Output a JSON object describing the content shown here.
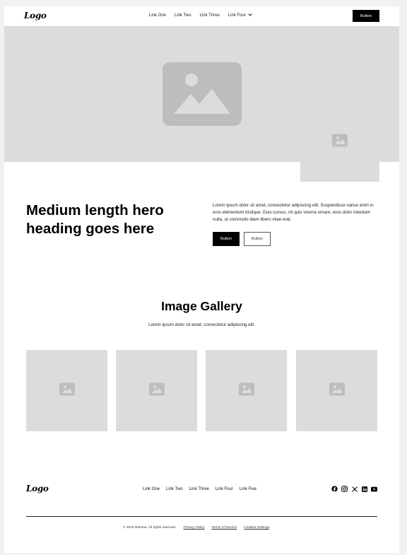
{
  "nav": {
    "logo": "Logo",
    "links": [
      "Link One",
      "Link Two",
      "Link Three",
      "Link Four"
    ],
    "button": "Button"
  },
  "hero": {
    "heading": "Medium length hero heading goes here",
    "body": "Lorem ipsum dolor sit amet, consectetur adipiscing elit. Suspendisse varius enim in eros elementum tristique. Duis cursus, mi quis viverra ornare, eros dolor interdum nulla, ut commodo diam libero vitae erat.",
    "primary_button": "Button",
    "secondary_button": "Button"
  },
  "gallery": {
    "heading": "Image Gallery",
    "subheading": "Lorem ipsum dolor sit amet, consectetur adipiscing elit.",
    "images": [
      "image-placeholder",
      "image-placeholder",
      "image-placeholder",
      "image-placeholder"
    ]
  },
  "footer": {
    "logo": "Logo",
    "links": [
      "Link One",
      "Link Two",
      "Link Three",
      "Link Four",
      "Link Five"
    ],
    "socials": [
      "facebook-icon",
      "instagram-icon",
      "x-icon",
      "linkedin-icon",
      "youtube-icon"
    ],
    "copyright": "© 2024 Relume. All rights reserved.",
    "legal": [
      "Privacy Policy",
      "Terms of Service",
      "Cookies Settings"
    ]
  },
  "colors": {
    "page_background": "#f1f1f1",
    "placeholder": "#dcdcdc",
    "placeholder_dark": "#bdbdbd",
    "primary": "#000000"
  }
}
